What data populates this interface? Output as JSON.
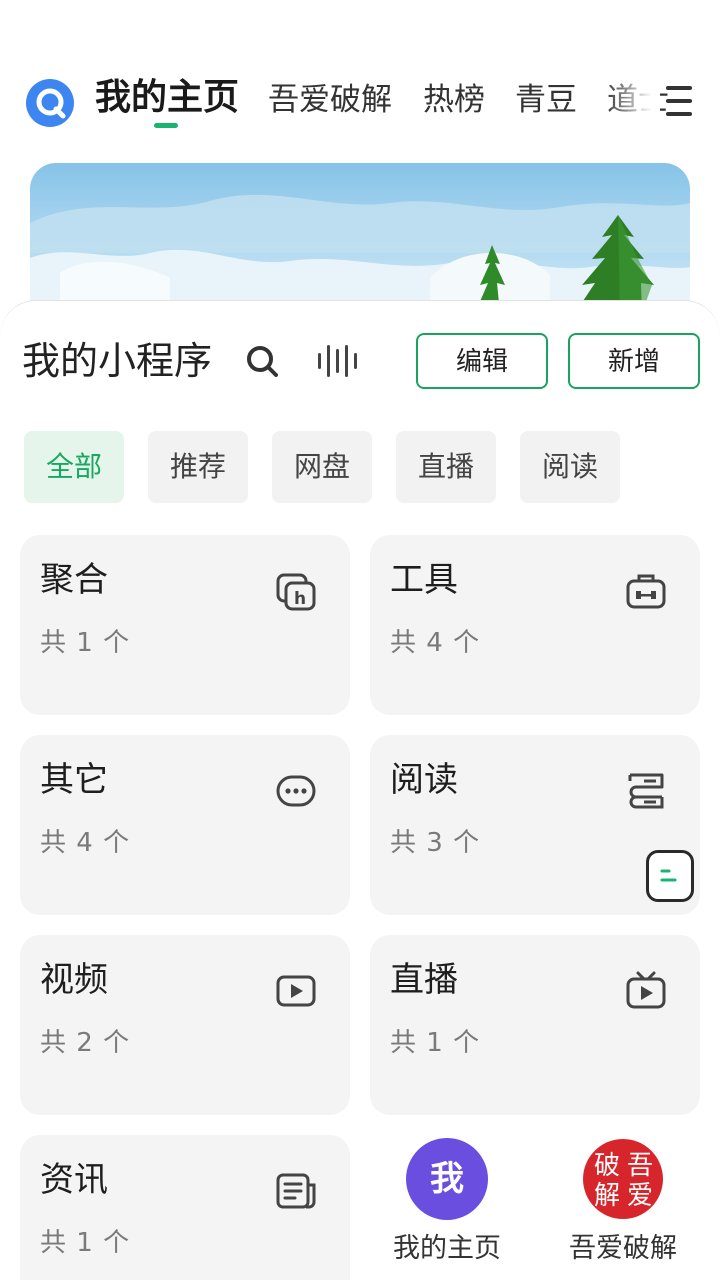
{
  "nav": {
    "tabs": [
      "我的主页",
      "吾爱破解",
      "热榜",
      "青豆",
      "道士"
    ],
    "active_index": 0,
    "accent": "#19b46f"
  },
  "sheet": {
    "title": "我的小程序",
    "edit_label": "编辑",
    "add_label": "新增"
  },
  "chips": [
    "全部",
    "推荐",
    "网盘",
    "直播",
    "阅读"
  ],
  "cards": [
    {
      "title": "聚合",
      "count": "共 1 个",
      "icon": "aggregate-icon"
    },
    {
      "title": "工具",
      "count": "共 4 个",
      "icon": "toolbox-icon"
    },
    {
      "title": "其它",
      "count": "共 4 个",
      "icon": "more-dots-icon"
    },
    {
      "title": "阅读",
      "count": "共 3 个",
      "icon": "book-icon"
    },
    {
      "title": "视频",
      "count": "共 2 个",
      "icon": "video-play-icon"
    },
    {
      "title": "直播",
      "count": "共 1 个",
      "icon": "tv-icon"
    },
    {
      "title": "资讯",
      "count": "共 1 个",
      "icon": "news-icon"
    }
  ],
  "dock": [
    {
      "avatar_text": "我",
      "label": "我的主页",
      "color": "#6a4ee0"
    },
    {
      "avatar_text": "吾爱破解",
      "label": "吾爱破解",
      "color": "#d7262b"
    }
  ]
}
